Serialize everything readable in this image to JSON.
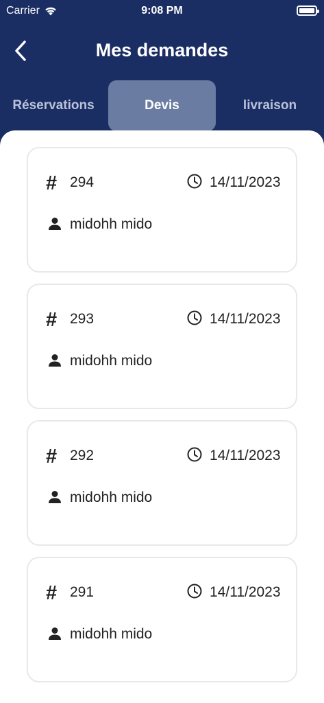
{
  "status_bar": {
    "carrier": "Carrier",
    "time": "9:08 PM",
    "icons": [
      "wifi-icon",
      "battery-icon"
    ]
  },
  "header": {
    "back_icon": "chevron-left-icon",
    "title": "Mes demandes"
  },
  "tabs": [
    {
      "label": "Réservations",
      "active": false
    },
    {
      "label": "Devis",
      "active": true
    },
    {
      "label": "livraison",
      "active": false
    }
  ],
  "requests": [
    {
      "hash": "#",
      "number": "294",
      "date": "14/11/2023",
      "client": "midohh mido"
    },
    {
      "hash": "#",
      "number": "293",
      "date": "14/11/2023",
      "client": "midohh mido"
    },
    {
      "hash": "#",
      "number": "292",
      "date": "14/11/2023",
      "client": "midohh mido"
    },
    {
      "hash": "#",
      "number": "291",
      "date": "14/11/2023",
      "client": "midohh mido"
    }
  ],
  "colors": {
    "header_bg": "#1b2e63",
    "active_tab_bg": "#6b7ca3",
    "card_border": "#e8e8ea"
  }
}
